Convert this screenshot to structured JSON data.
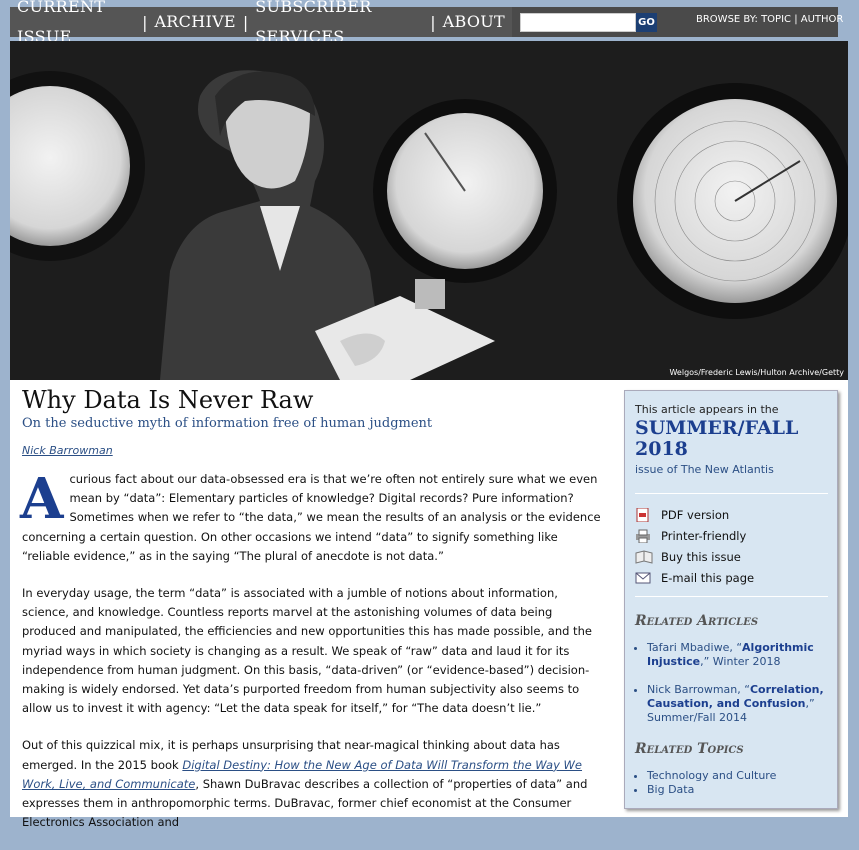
{
  "nav": {
    "items": [
      "CURRENT ISSUE",
      "ARCHIVE",
      "SUBSCRIBER SERVICES",
      "ABOUT"
    ],
    "search_placeholder": "",
    "go_label": "GO",
    "browse_by": "BROWSE BY:",
    "topic": "TOPIC",
    "author": "AUTHOR"
  },
  "hero": {
    "credit": "Welgos/Frederic Lewis/Hulton Archive/Getty"
  },
  "article": {
    "title": "Why Data Is Never Raw",
    "subtitle": "On the seductive myth of information free of human judgment",
    "author": "Nick Barrowman",
    "dropcap": "A",
    "p1": "curious fact about our data-obsessed era is that we’re often not entirely sure what we even mean by “data”: Elementary particles of knowledge? Digital records? Pure information? Sometimes when we refer to “the data,” we mean the results of an analysis or the evidence concerning a certain question. On other occasions we intend “data” to signify something like “reliable evidence,” as in the saying “The plural of anecdote is not data.”",
    "p2": "In everyday usage, the term “data” is associated with a jumble of notions about information, science, and knowledge. Countless reports marvel at the astonishing volumes of data being produced and manipulated, the efficiencies and new opportunities this has made possible, and the myriad ways in which society is changing as a result. We speak of “raw” data and laud it for its independence from human judgment. On this basis, “data-driven” (or “evidence-based”) decision-making is widely endorsed. Yet data’s purported freedom from human subjectivity also seems to allow us to invest it with agency: “Let the data speak for itself,” for “The data doesn’t lie.”",
    "p3_start": "Out of this quizzical mix, it is perhaps unsurprising that near-magical thinking about data has emerged. In the 2015 book ",
    "p3_link": "Digital Destiny: How the New Age of Data Will Transform the Way We Work, Live, and Communicate",
    "p3_end": ", Shawn DuBravac describes a collection of “properties of data” and expresses them in anthropomorphic terms. DuBravac, former chief economist at the Consumer Electronics Association and"
  },
  "sidebar": {
    "appears": "This article appears in the",
    "issue": "SUMMER/FALL 2018",
    "of": "issue of The New Atlantis",
    "tools": [
      {
        "icon": "pdf-icon",
        "label": "PDF version"
      },
      {
        "icon": "printer-icon",
        "label": "Printer-friendly"
      },
      {
        "icon": "book-icon",
        "label": "Buy this issue"
      },
      {
        "icon": "email-icon",
        "label": "E-mail this page"
      }
    ],
    "related_articles_title": "Related Articles",
    "related_articles": [
      {
        "author": "Tafari Mbadiwe, “",
        "title": "Algorithmic Injustice",
        "issue": ",” Winter 2018"
      },
      {
        "author": "Nick Barrowman, “",
        "title": "Correlation, Causation, and Confusion",
        "issue": ",” Summer/Fall 2014"
      }
    ],
    "related_topics_title": "Related Topics",
    "related_topics": [
      "Technology and Culture",
      "Big Data"
    ]
  }
}
